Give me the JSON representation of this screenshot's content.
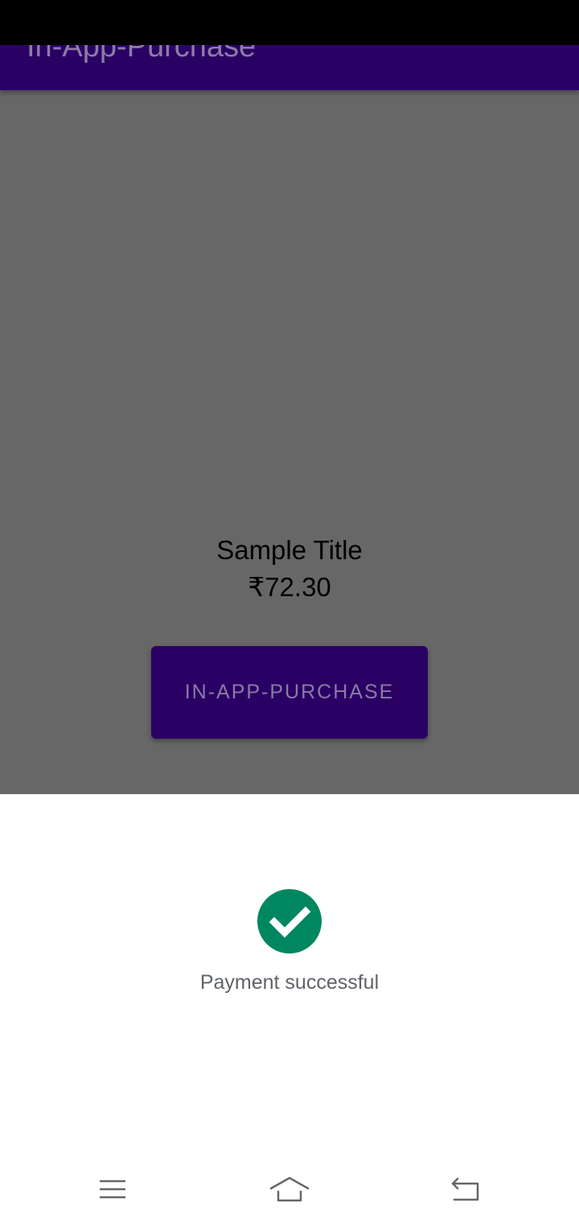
{
  "app": {
    "title": "In-App-Purchase"
  },
  "product": {
    "title": "Sample Title",
    "price": "₹72.30"
  },
  "purchase_button": {
    "label": "IN-APP-PURCHASE"
  },
  "payment_sheet": {
    "status_text": "Payment successful",
    "status_icon": "check-circle-icon",
    "status_color": "#01875f"
  },
  "nav_bar": {
    "buttons": [
      "menu-icon",
      "home-icon",
      "back-icon"
    ]
  },
  "colors": {
    "primary": "#2a0065",
    "scrim_background": "#676767",
    "status_bar": "#000000"
  }
}
